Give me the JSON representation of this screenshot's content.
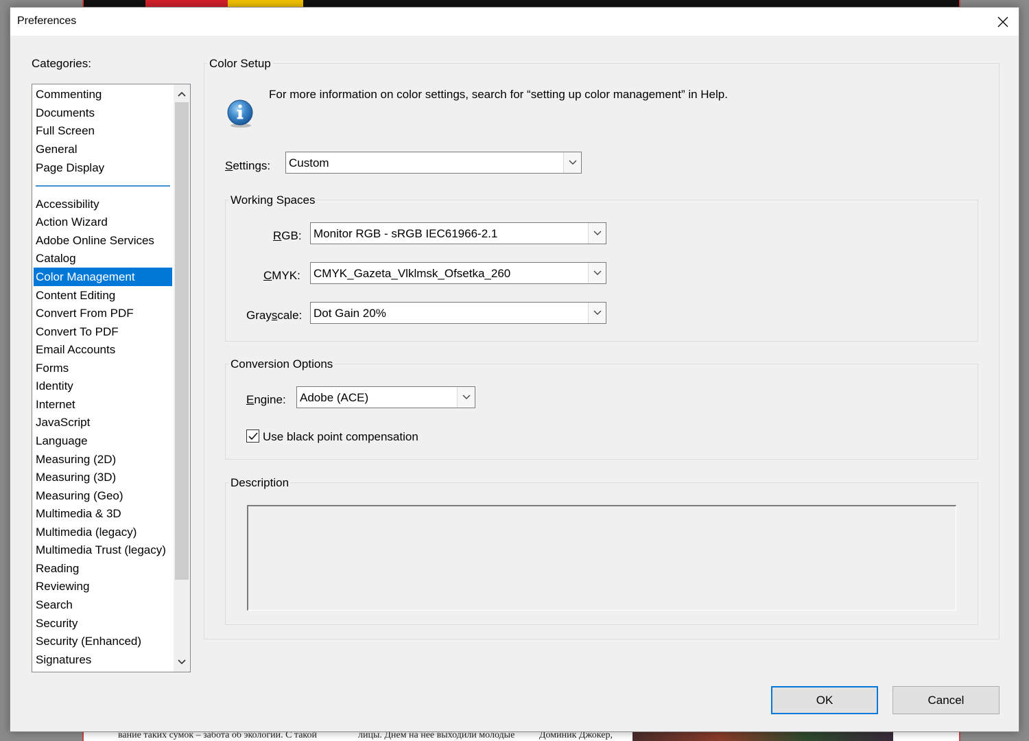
{
  "background_doc": {
    "text_left": "вание таких сумок – забота об экологии. С такой",
    "text_middle": "лицы. Днем на нее выходили молодые",
    "text_right": "Доминик Джокер,"
  },
  "dialog": {
    "title": "Preferences"
  },
  "categories": {
    "label": "Categories:",
    "pinned": [
      "Commenting",
      "Documents",
      "Full Screen",
      "General",
      "Page Display"
    ],
    "items": [
      "Accessibility",
      "Action Wizard",
      "Adobe Online Services",
      "Catalog",
      "Color Management",
      "Content Editing",
      "Convert From PDF",
      "Convert To PDF",
      "Email Accounts",
      "Forms",
      "Identity",
      "Internet",
      "JavaScript",
      "Language",
      "Measuring (2D)",
      "Measuring (3D)",
      "Measuring (Geo)",
      "Multimedia & 3D",
      "Multimedia (legacy)",
      "Multimedia Trust (legacy)",
      "Reading",
      "Reviewing",
      "Search",
      "Security",
      "Security (Enhanced)",
      "Signatures"
    ],
    "selected": "Color Management",
    "selection_color": "#0078d7"
  },
  "panel": {
    "title": "Color Setup",
    "info_text": "For more information on color settings, search for “setting up color management” in Help.",
    "settings_label": "Settings:",
    "settings_value": "Custom",
    "working_spaces": {
      "title": "Working Spaces",
      "rgb_label": "RGB:",
      "rgb_value": "Monitor RGB - sRGB IEC61966-2.1",
      "cmyk_label": "CMYK:",
      "cmyk_value": "CMYK_Gazeta_Vlklmsk_Ofsetka_260",
      "grayscale_label": "Grayscale:",
      "grayscale_value": "Dot Gain 20%"
    },
    "conversion": {
      "title": "Conversion Options",
      "engine_label": "Engine:",
      "engine_value": "Adobe (ACE)",
      "bpc_label": "Use black point compensation",
      "bpc_checked": true
    },
    "description": {
      "title": "Description",
      "text": ""
    }
  },
  "buttons": {
    "ok": "OK",
    "cancel": "Cancel"
  },
  "icons": {
    "close": "close-icon",
    "info": "info-icon",
    "chevron": "chevron-down-icon"
  }
}
